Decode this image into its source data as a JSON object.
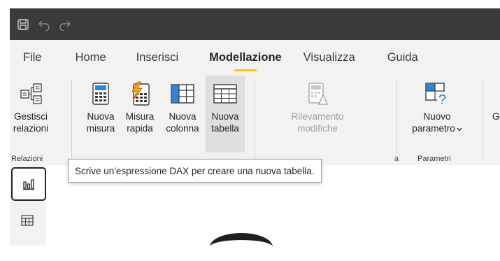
{
  "quick_access": {
    "icons": [
      "save-icon",
      "undo-icon",
      "redo-icon"
    ]
  },
  "tabs": [
    {
      "label": "File",
      "active": false
    },
    {
      "label": "Home",
      "active": false
    },
    {
      "label": "Inserisci",
      "active": false
    },
    {
      "label": "Modellazione",
      "active": true
    },
    {
      "label": "Visualizza",
      "active": false
    },
    {
      "label": "Guida",
      "active": false
    }
  ],
  "ribbon": {
    "relazioni": {
      "gestisci": {
        "line1": "Gestisci",
        "line2": "relazioni"
      },
      "group_label": "Relazioni"
    },
    "calcoli": {
      "nuova_misura": {
        "line1": "Nuova",
        "line2": "misura"
      },
      "misura_rapida": {
        "line1": "Misura",
        "line2": "rapida"
      },
      "nuova_colonna": {
        "line1": "Nuova",
        "line2": "colonna"
      },
      "nuova_tabella": {
        "line1": "Nuova",
        "line2": "tabella"
      }
    },
    "rilevamento": {
      "button": {
        "line1": "Rilevamento",
        "line2": "modifiche"
      },
      "group_label_fragment": "a"
    },
    "parametri": {
      "nuovo_parametro": {
        "line1": "Nuovo",
        "line2": "parametro"
      },
      "group_label": "Parametri"
    },
    "partial_button_text": "G"
  },
  "tooltip": {
    "text": "Scrive un'espressione DAX per creare una nuova tabella."
  },
  "left_nav": {
    "icons": [
      "report-view-icon",
      "data-view-icon"
    ]
  },
  "colors": {
    "titlebar": "#3b3a39",
    "ribbon_bg": "#f3f2f1",
    "accent_underline": "#f2c811",
    "icon_blue": "#2b88d8",
    "icon_dark": "#3b3a39",
    "bolt_orange": "#f2a900"
  }
}
